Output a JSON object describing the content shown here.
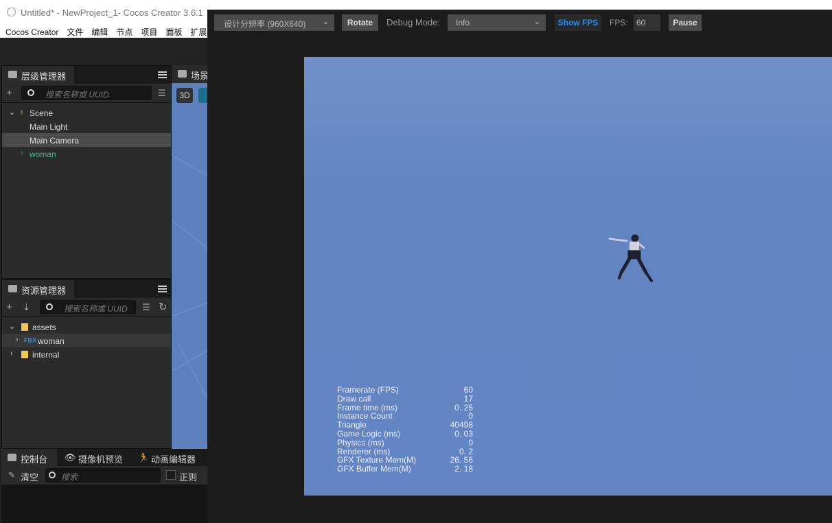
{
  "editor": {
    "title": "Untitled* - NewProject_1- Cocos Creator 3.6.1",
    "menu": [
      "Cocos Creator",
      "文件",
      "编辑",
      "节点",
      "项目",
      "面板",
      "扩展"
    ],
    "hierarchy": {
      "tab": "层级管理器",
      "search_placeholder": "搜索名称或 UUID",
      "items": [
        {
          "label": "Scene",
          "level": 0,
          "expanded": true
        },
        {
          "label": "Main Light",
          "level": 1
        },
        {
          "label": "Main Camera",
          "level": 1,
          "selected": true
        },
        {
          "label": "woman",
          "level": 1,
          "collapsed": true,
          "color": "#3fbf8a"
        }
      ]
    },
    "scene": {
      "tab": "场景",
      "mode_3d": "3D"
    },
    "assets": {
      "tab": "资源管理器",
      "search_placeholder": "搜索名称或 UUID",
      "items": [
        {
          "label": "assets",
          "type": "folder",
          "expanded": true
        },
        {
          "label": "woman",
          "type": "FBX",
          "badge": "FBX"
        },
        {
          "label": "internal",
          "type": "folder"
        }
      ]
    },
    "console": {
      "tabs": [
        "控制台",
        "摄像机预览",
        "动画编辑器"
      ],
      "clear": "清空",
      "search_placeholder": "搜索",
      "regex": "正则",
      "regex_checked": false
    }
  },
  "preview": {
    "resolution": "设计分辨率 (960X640)",
    "rotate": "Rotate",
    "debug_label": "Debug Mode:",
    "debug_value": "Info",
    "show_fps": "Show FPS",
    "fps_label": "FPS:",
    "fps_value": "60",
    "pause": "Pause",
    "colors": {
      "canvas": "#6687c4",
      "show_fps": "#1e90ff"
    },
    "stats": [
      {
        "label": "Framerate (FPS)",
        "value": "60"
      },
      {
        "label": "Draw call",
        "value": "17"
      },
      {
        "label": "Frame time (ms)",
        "value": "0. 25"
      },
      {
        "label": "Instance Count",
        "value": "0"
      },
      {
        "label": "Triangle",
        "value": "40498"
      },
      {
        "label": "Game Logic (ms)",
        "value": "0. 03"
      },
      {
        "label": "Physics (ms)",
        "value": "0"
      },
      {
        "label": "Renderer (ms)",
        "value": "0. 2"
      },
      {
        "label": "GFX Texture Mem(M)",
        "value": "26. 56"
      },
      {
        "label": "GFX Buffer Mem(M)",
        "value": "2. 18"
      }
    ]
  }
}
